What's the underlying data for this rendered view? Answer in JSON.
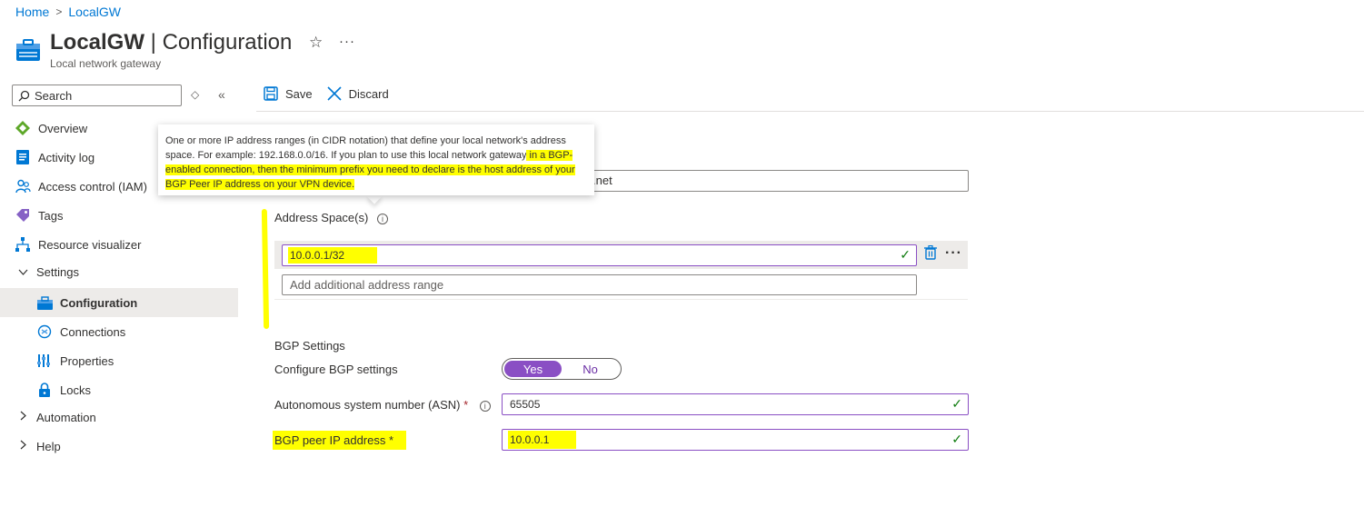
{
  "breadcrumb": {
    "home": "Home",
    "separator": ">",
    "current": "LocalGW"
  },
  "header": {
    "resource_name": "LocalGW",
    "separator": " | ",
    "section": "Configuration",
    "subtitle": "Local network gateway",
    "star_icon": "☆",
    "more_icon": "···"
  },
  "search": {
    "placeholder": "Search",
    "updown_icon": "◇",
    "collapse_icon": "«"
  },
  "nav": {
    "overview": "Overview",
    "activity_log": "Activity log",
    "access_control": "Access control (IAM)",
    "tags": "Tags",
    "resource_visualizer": "Resource visualizer",
    "settings": "Settings",
    "configuration": "Configuration",
    "connections": "Connections",
    "properties": "Properties",
    "locks": "Locks",
    "automation": "Automation",
    "help": "Help"
  },
  "toolbar": {
    "save": "Save",
    "discard": "Discard"
  },
  "tooltip": {
    "part1": "One or more IP address ranges (in CIDR notation) that define your local network's address space. For example: 192.168.0.0/16. If you plan to use this local network gateway",
    "part2": " in a BGP-enabled connection, then the minimum prefix you need to declare is the host address of your BGP Peer IP address on your VPN device."
  },
  "partial_field": {
    "value": ".net"
  },
  "address_space": {
    "label": "Address Space(s)",
    "info_icon": "i",
    "value": "10.0.0.1/32",
    "add_placeholder": "Add additional address range",
    "check_icon": "✓",
    "more_icon": "···"
  },
  "bgp": {
    "heading": "BGP Settings",
    "configure_label": "Configure BGP settings",
    "toggle_yes": "Yes",
    "toggle_no": "No",
    "asn_label": "Autonomous system number (ASN)",
    "required_marker": "*",
    "asn_value": "65505",
    "peer_label": "BGP peer IP address *",
    "peer_value": "10.0.0.1",
    "check_icon": "✓"
  },
  "colors": {
    "accent": "#0078d4",
    "toggle_on": "#8a4fc4",
    "highlight": "#ffff00",
    "check": "#107c10"
  }
}
